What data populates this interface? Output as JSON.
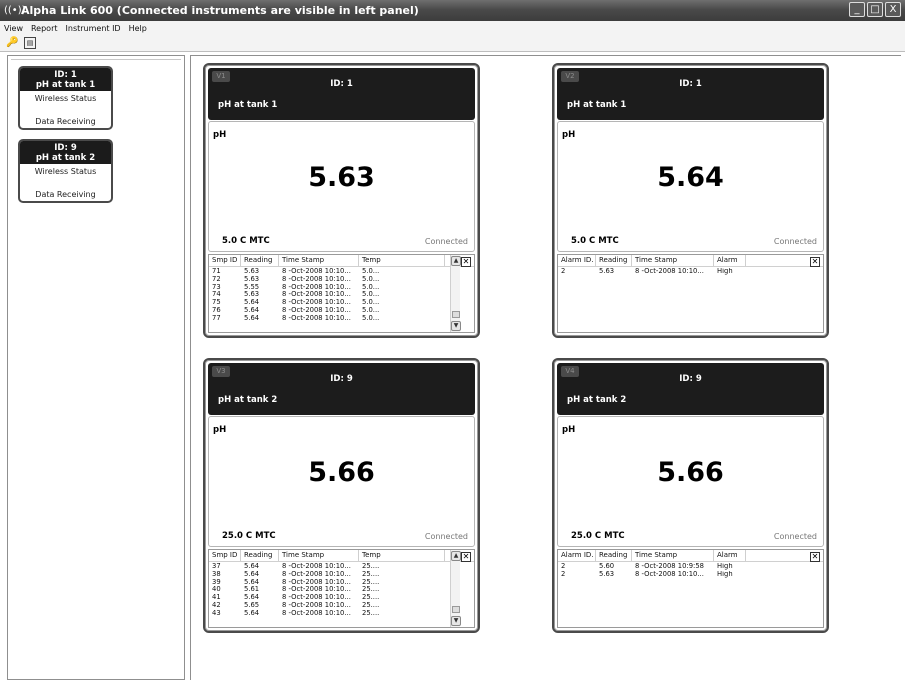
{
  "window": {
    "title": "Alpha Link 600  (Connected instruments are visible in left panel)",
    "title_icon": "((•))",
    "buttons": [
      "_",
      "□",
      "X"
    ]
  },
  "menu": [
    "View",
    "Report",
    "Instrument ID",
    "Help"
  ],
  "toolbar": {
    "tool1_icon": "key-icon",
    "tool1_glyph": "🔑",
    "tool2_icon": "calculator-icon",
    "tool2_glyph": "▤"
  },
  "instruments": [
    {
      "id": "ID: 1",
      "name": "pH at tank 1",
      "wireless": "Wireless Status",
      "status": "Data Receiving"
    },
    {
      "id": "ID: 9",
      "name": "pH at tank 2",
      "wireless": "Wireless Status",
      "status": "Data Receiving"
    }
  ],
  "views": [
    {
      "tag": "V1",
      "id": "ID: 1",
      "name": "pH at tank 1",
      "param": "pH",
      "reading": "5.63",
      "temp": "5.0 C MTC",
      "status": "Connected",
      "type": "samples",
      "headers": [
        "Smp ID",
        "Reading",
        "Time Stamp",
        "Temp"
      ],
      "rows": [
        [
          "71",
          "5.63",
          "8 -Oct-2008 10:10...",
          "5.0..."
        ],
        [
          "72",
          "5.63",
          "8 -Oct-2008 10:10...",
          "5.0..."
        ],
        [
          "73",
          "5.55",
          "8 -Oct-2008 10:10...",
          "5.0..."
        ],
        [
          "74",
          "5.63",
          "8 -Oct-2008 10:10...",
          "5.0..."
        ],
        [
          "75",
          "5.64",
          "8 -Oct-2008 10:10...",
          "5.0..."
        ],
        [
          "76",
          "5.64",
          "8 -Oct-2008 10:10...",
          "5.0..."
        ],
        [
          "77",
          "5.64",
          "8 -Oct-2008 10:10...",
          "5.0..."
        ]
      ]
    },
    {
      "tag": "V2",
      "id": "ID: 1",
      "name": "pH at tank 1",
      "param": "pH",
      "reading": "5.64",
      "temp": "5.0 C MTC",
      "status": "Connected",
      "type": "alarms",
      "headers": [
        "Alarm ID.",
        "Reading",
        "Time Stamp",
        "Alarm"
      ],
      "rows": [
        [
          "2",
          "5.63",
          "8 -Oct-2008 10:10...",
          "High"
        ]
      ]
    },
    {
      "tag": "V3",
      "id": "ID: 9",
      "name": "pH at tank 2",
      "param": "pH",
      "reading": "5.66",
      "temp": "25.0 C MTC",
      "status": "Connected",
      "type": "samples",
      "headers": [
        "Smp ID",
        "Reading",
        "Time Stamp",
        "Temp"
      ],
      "rows": [
        [
          "37",
          "5.64",
          "8 -Oct-2008 10:10...",
          "25...."
        ],
        [
          "38",
          "5.64",
          "8 -Oct-2008 10:10...",
          "25...."
        ],
        [
          "39",
          "5.64",
          "8 -Oct-2008 10:10...",
          "25...."
        ],
        [
          "40",
          "5.61",
          "8 -Oct-2008 10:10...",
          "25...."
        ],
        [
          "41",
          "5.64",
          "8 -Oct-2008 10:10...",
          "25...."
        ],
        [
          "42",
          "5.65",
          "8 -Oct-2008 10:10...",
          "25...."
        ],
        [
          "43",
          "5.64",
          "8 -Oct-2008 10:10...",
          "25...."
        ]
      ]
    },
    {
      "tag": "V4",
      "id": "ID: 9",
      "name": "pH at tank 2",
      "param": "pH",
      "reading": "5.66",
      "temp": "25.0 C MTC",
      "status": "Connected",
      "type": "alarms",
      "headers": [
        "Alarm ID.",
        "Reading",
        "Time Stamp",
        "Alarm"
      ],
      "rows": [
        [
          "2",
          "5.60",
          "8 -Oct-2008 10:9:58",
          "High"
        ],
        [
          "2",
          "5.63",
          "8 -Oct-2008 10:10...",
          "High"
        ]
      ]
    }
  ],
  "scroll": {
    "up": "▲",
    "down": "▼"
  },
  "close_glyph": "✕"
}
